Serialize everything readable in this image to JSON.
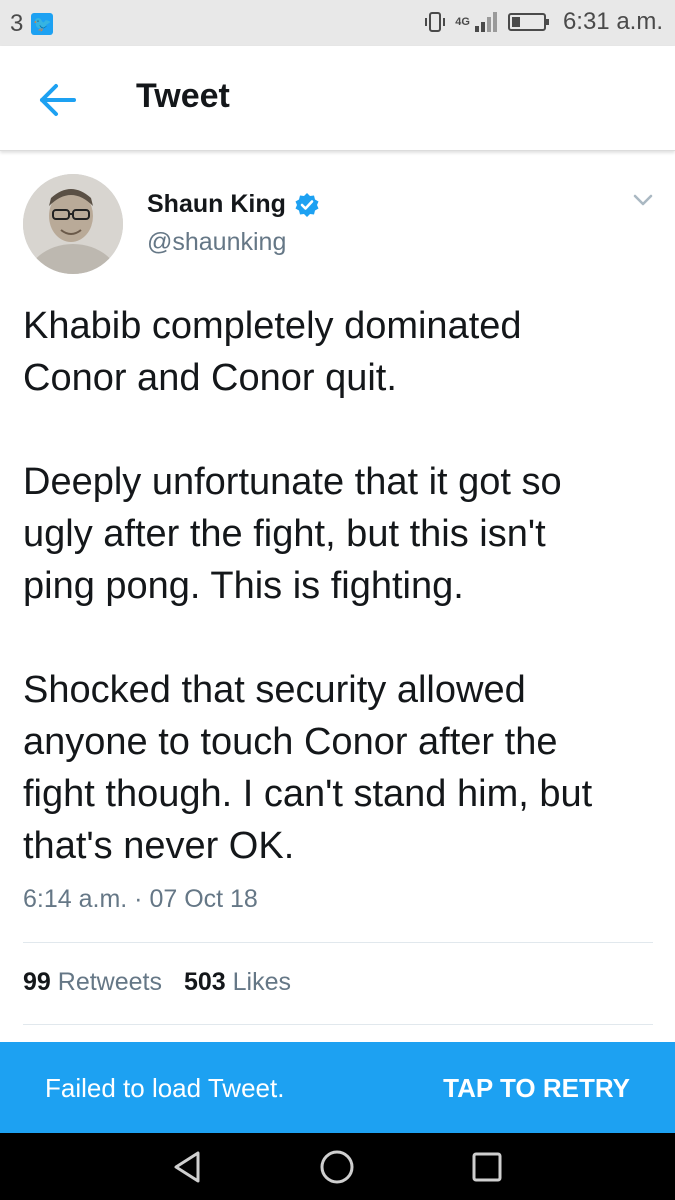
{
  "status_bar": {
    "notification_count": "3",
    "notification_icon": "twitter-bird-icon",
    "network": "4G",
    "time": "6:31 a.m."
  },
  "app_bar": {
    "title": "Tweet",
    "back_icon": "arrow-left-icon"
  },
  "tweet": {
    "author_name": "Shaun King",
    "author_handle": "@shaunking",
    "verified": true,
    "text": "Khabib completely dominated\nConor and Conor quit.\n\nDeeply unfortunate that it got so\nugly after the fight, but this isn't\nping pong. This is fighting.\n\nShocked that security allowed\nanyone to touch Conor after the\nfight though. I can't stand him, but\nthat's never OK.",
    "timestamp": "6:14 a.m. · 07 Oct 18",
    "retweets_count": "99",
    "retweets_label": "Retweets",
    "likes_count": "503",
    "likes_label": "Likes"
  },
  "snackbar": {
    "message": "Failed to load Tweet.",
    "action": "TAP TO RETRY"
  },
  "colors": {
    "accent": "#1da1f2",
    "secondary_text": "#657786",
    "primary_text": "#14171a"
  }
}
